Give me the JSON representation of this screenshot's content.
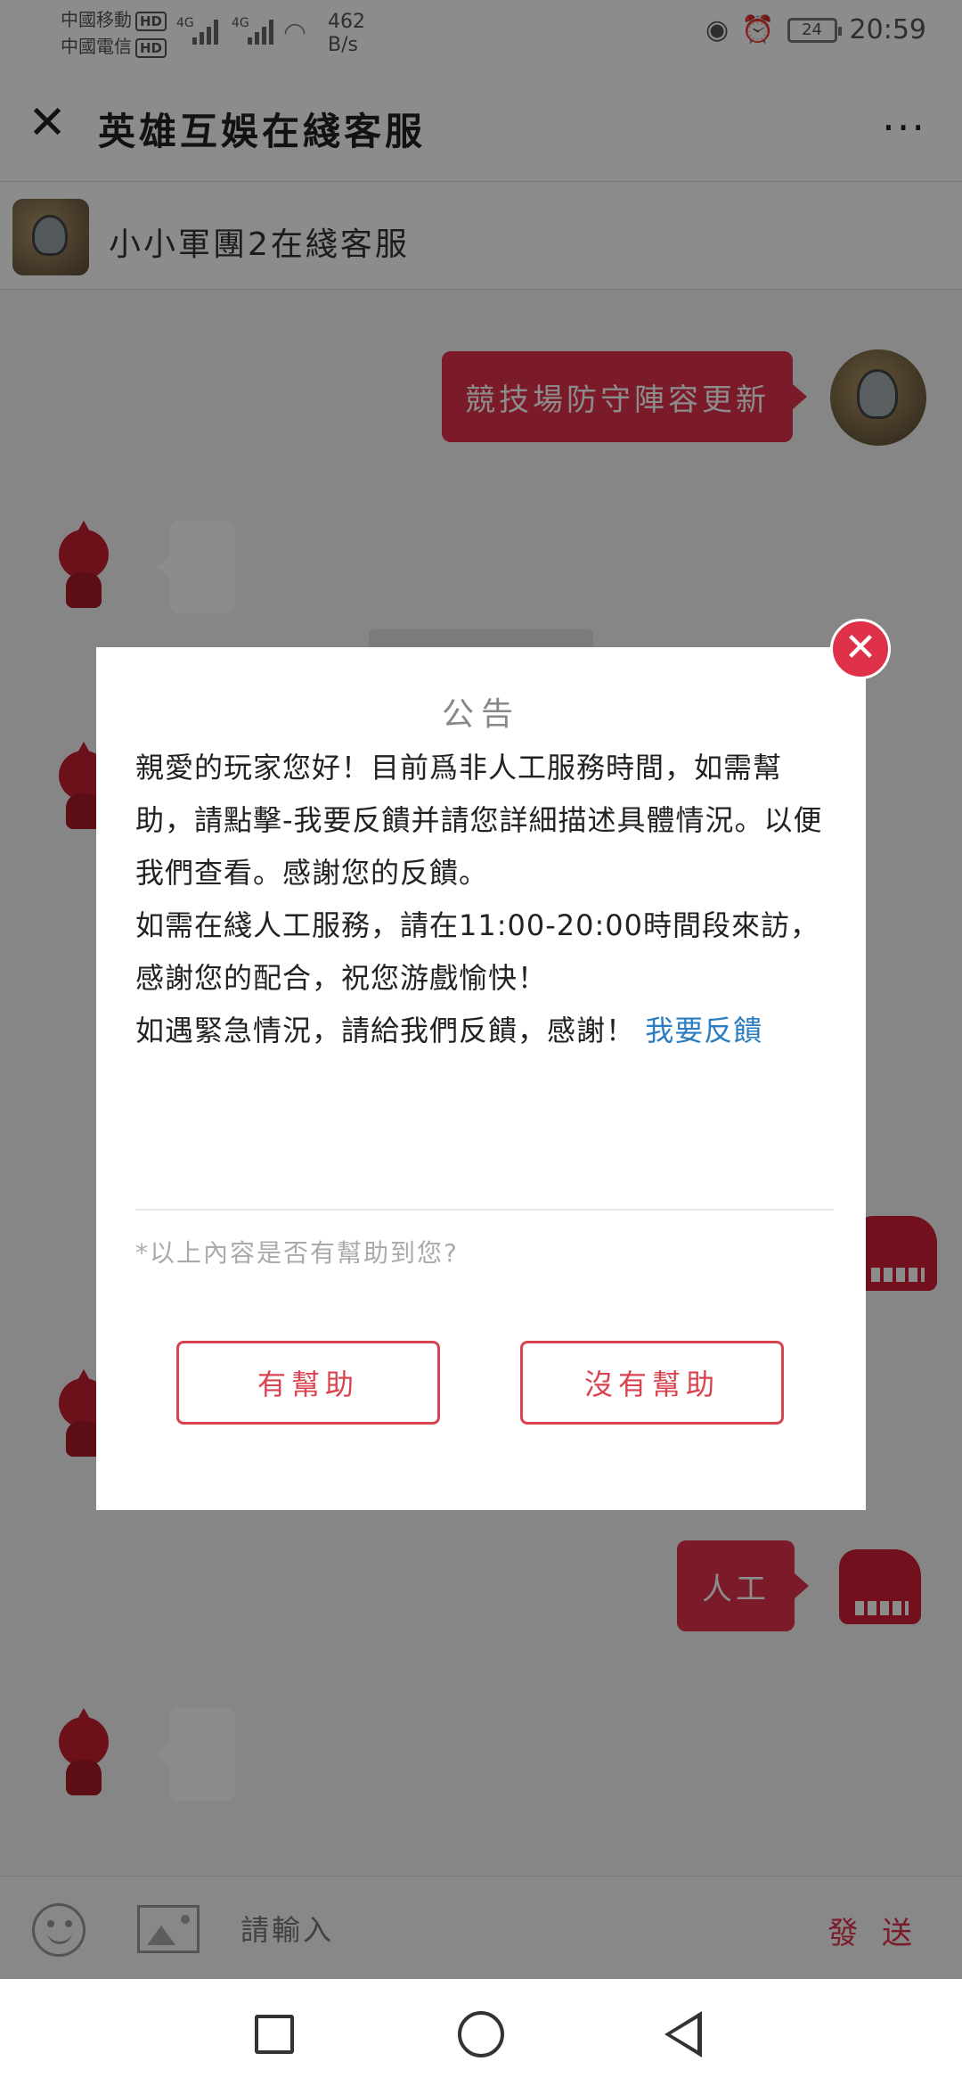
{
  "status_bar": {
    "carrier1": "中國移動",
    "carrier2": "中國電信",
    "hd": "HD",
    "network1": "4G",
    "network2": "4G",
    "speed_value": "462",
    "speed_unit": "B/s",
    "battery": "24",
    "time": "20:59"
  },
  "header": {
    "title": "英雄互娛在綫客服",
    "more": "···"
  },
  "subheader": {
    "name": "小小軍團2在綫客服"
  },
  "chat": {
    "messages": [
      {
        "text": "競技場防守陣容更新"
      },
      {
        "text": "人工"
      }
    ]
  },
  "modal": {
    "title": "公告",
    "body_p1": "親愛的玩家您好！目前爲非人工服務時間，如需幫助，請點擊-我要反饋并請您詳細描述具體情況。以便我們查看。感謝您的反饋。",
    "body_p2": "如需在綫人工服務，請在11:00-20:00時間段來訪，感謝您的配合，祝您游戲愉快！",
    "body_p3": "如遇緊急情況，請給我們反饋，感謝！",
    "feedback_link": "我要反饋",
    "question": "*以上內容是否有幫助到您?",
    "helpful_button": "有幫助",
    "not_helpful_button": "沒有幫助"
  },
  "input_bar": {
    "placeholder": "請輸入",
    "send_label": "發 送"
  }
}
